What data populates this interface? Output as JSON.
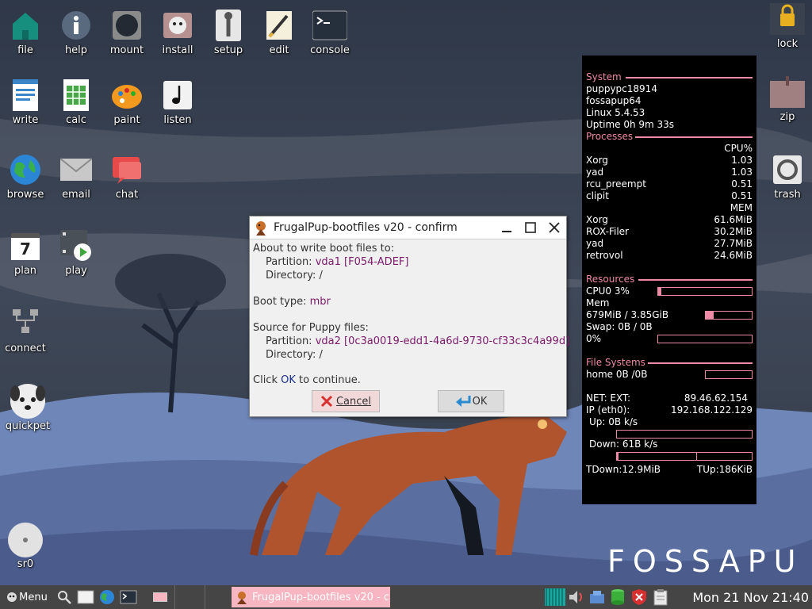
{
  "desktop": {
    "icons": {
      "file": "file",
      "help": "help",
      "mount": "mount",
      "install": "install",
      "setup": "setup",
      "edit": "edit",
      "console": "console",
      "write": "write",
      "calc": "calc",
      "paint": "paint",
      "listen": "listen",
      "browse": "browse",
      "email": "email",
      "chat": "chat",
      "plan": "plan",
      "play": "play",
      "connect": "connect",
      "quickpet": "quickpet",
      "sr0": "sr0",
      "lock": "lock",
      "zip": "zip",
      "trash": "trash"
    },
    "plan_day": "7",
    "brand": "FOSSAPU"
  },
  "conky": {
    "system": {
      "heading": "System",
      "hostname": "puppypc18914",
      "distro": "fossapup64",
      "kernel": "Linux 5.4.53",
      "uptime": "Uptime 0h 9m 33s"
    },
    "processes": {
      "heading": "Processes",
      "cpu_header": "CPU%",
      "cpu": [
        {
          "name": "Xorg",
          "value": "1.03"
        },
        {
          "name": "yad",
          "value": "1.03"
        },
        {
          "name": "rcu_preempt",
          "value": "0.51"
        },
        {
          "name": "clipit",
          "value": "0.51"
        }
      ],
      "mem_header": "MEM",
      "mem": [
        {
          "name": "Xorg",
          "value": "61.6MiB"
        },
        {
          "name": "ROX-Filer",
          "value": "30.2MiB"
        },
        {
          "name": "yad",
          "value": "27.7MiB"
        },
        {
          "name": "retrovol",
          "value": "24.6MiB"
        }
      ]
    },
    "resources": {
      "heading": "Resources",
      "cpu0": "CPU0 3%",
      "cpu0_fraction": 0.03,
      "mem_label": "Mem",
      "mem_value": "679MiB / 3.85GiB",
      "mem_fraction": 0.17,
      "swap": "Swap: 0B  / 0B",
      "swap_pct": "0%",
      "swap_fraction": 0
    },
    "filesystems": {
      "heading": "File Systems",
      "home": "home 0B  /0B",
      "home_fraction": 0
    },
    "network": {
      "ext_label": "NET: EXT:",
      "ext_ip": "89.46.62.154",
      "ip_label": "IP (eth0):",
      "ip": "192.168.122.129",
      "up": "Up: 0B   k/s",
      "up_fraction": 0,
      "down": "Down: 61B  k/s",
      "down_fraction": 0.01,
      "tdown": "TDown:12.9MiB",
      "tup": "TUp:186KiB"
    }
  },
  "dialog": {
    "title": "FrugalPup-bootfiles v20 - confirm",
    "line1": "About to write boot files to:",
    "partition_label": "Partition: ",
    "partition_value": "vda1 [F054-ADEF]",
    "directory_label": "Directory: ",
    "directory_value": "/",
    "boot_type_label": "Boot type: ",
    "boot_type_value": "mbr",
    "source_line": "Source for Puppy files:",
    "source_partition_label": "Partition: ",
    "source_partition_value": "vda2 [0c3a0019-edd1-4a6d-9730-cf33c3c4a99d]",
    "source_directory_label": "Directory: ",
    "source_directory_value": "/",
    "click_prefix": "Click ",
    "click_ok": "OK",
    "click_suffix": " to continue.",
    "cancel_label": "Cancel",
    "ok_label": "OK"
  },
  "taskbar": {
    "menu_label": "Menu",
    "task_title": "FrugalPup-bootfiles v20 - c",
    "clock": "Mon 21 Nov 21:40"
  },
  "colors": {
    "accent_pink": "#ef8aa6",
    "task_pink": "#f7b6c1",
    "dialog_value": "#7a1a6a",
    "ok_blue": "#1a2f8a"
  }
}
